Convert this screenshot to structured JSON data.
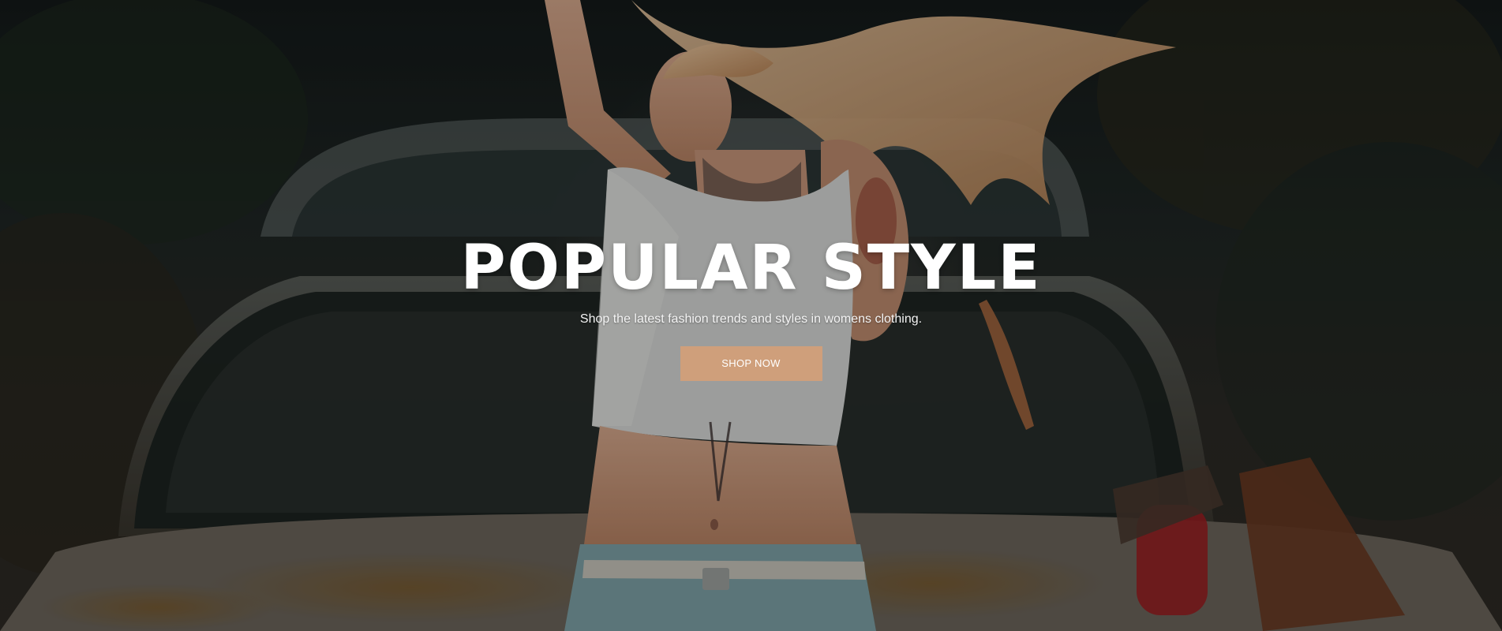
{
  "hero": {
    "title": "POPULAR STYLE",
    "subtitle": "Shop the latest fashion trends and styles in womens clothing.",
    "cta_label": "SHOP NOW"
  },
  "colors": {
    "cta_background": "#cf9f7b",
    "text": "#ffffff"
  }
}
